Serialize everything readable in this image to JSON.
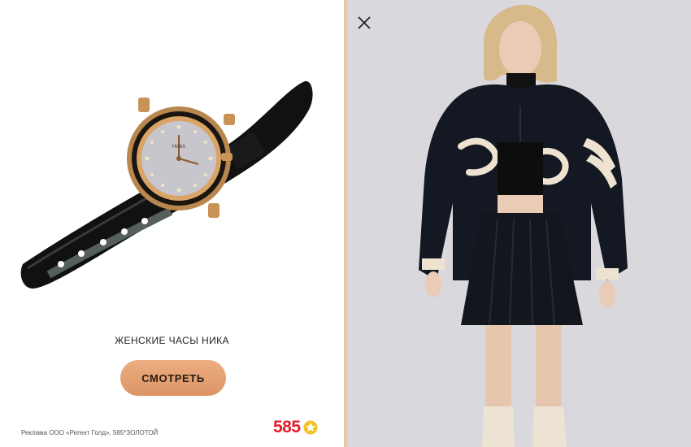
{
  "ad": {
    "product_title": "ЖЕНСКИЕ ЧАСЫ НИКА",
    "cta_label": "СМОТРЕТЬ",
    "disclaimer": "Реклама ООО «Регент Голд», 585*ЗОЛОТОЙ",
    "brand": "585",
    "watch_dial_text": "НИКА"
  },
  "photo": {
    "jacket_text": "Fateh Pop"
  },
  "icons": {
    "close": "close-icon",
    "star": "star-icon",
    "watch": "watch-image",
    "model": "model-photo"
  },
  "colors": {
    "accent": "#e41e2b",
    "button": "#e5a176",
    "divider": "#e6c8a8",
    "photo_bg": "#d9d8dc"
  }
}
